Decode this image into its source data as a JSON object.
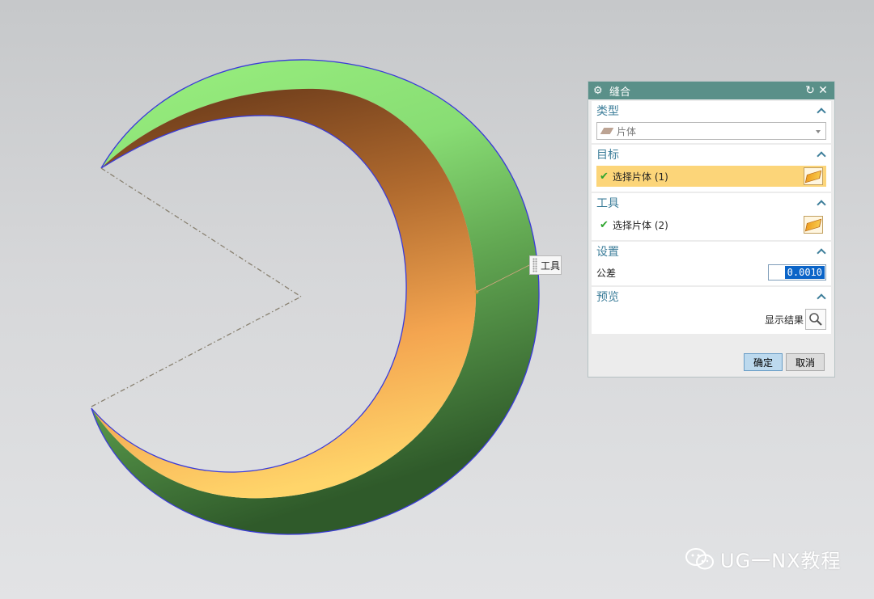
{
  "tool_label": "工具",
  "dialog": {
    "title": "缝合",
    "sections": {
      "type": {
        "header": "类型",
        "select_value": "片体"
      },
      "target": {
        "header": "目标",
        "select_label": "选择片体 (1)"
      },
      "tool": {
        "header": "工具",
        "select_label": "选择片体 (2)"
      },
      "settings": {
        "header": "设置",
        "tolerance_label": "公差",
        "tolerance_value": "0.0010"
      },
      "preview": {
        "header": "预览",
        "show_result_label": "显示结果"
      }
    },
    "buttons": {
      "ok": "确定",
      "cancel": "取消"
    }
  },
  "watermark": "UG一NX教程",
  "colors": {
    "outer_surface": "#8ed87a",
    "inner_surface": "#f0a94c",
    "edge": "#3b3bd8",
    "titlebar": "#5a9089",
    "highlight_row": "#fcd579"
  }
}
